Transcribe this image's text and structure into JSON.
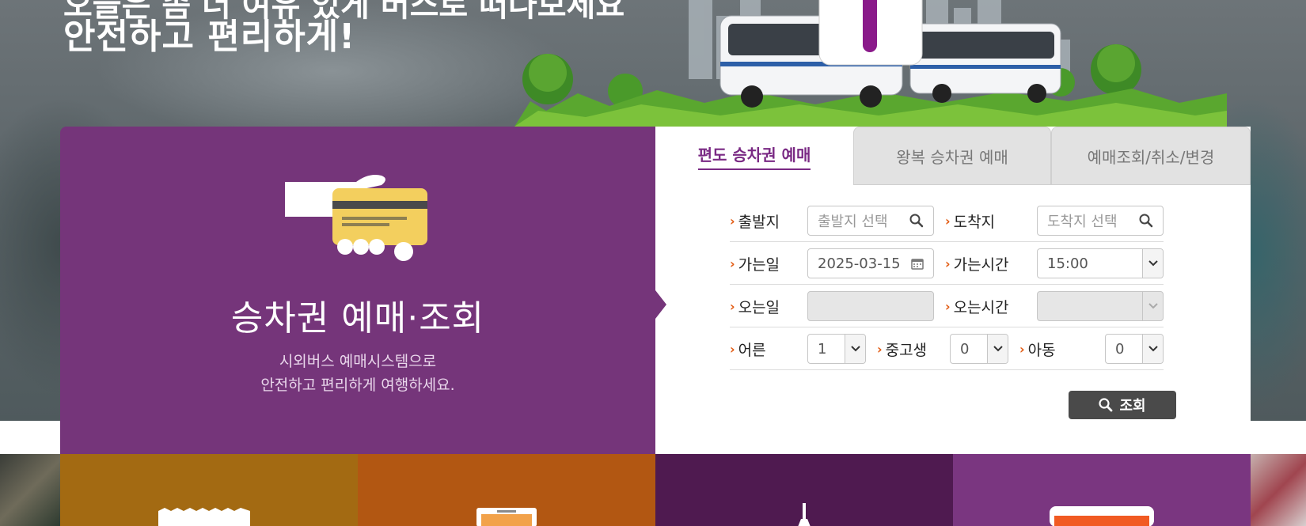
{
  "hero": {
    "title_top": "오늘은 좀 더 여유 있게 버스로 떠나보세요",
    "title": "안전하고 편리하게!"
  },
  "booking": {
    "panel_title": "승차권 예매·조회",
    "desc_line1": "시외버스 예매시스템으로",
    "desc_line2": "안전하고 편리하게 여행하세요."
  },
  "tabs": [
    {
      "label": "편도 승차권 예매",
      "active": true
    },
    {
      "label": "왕복 승차권 예매",
      "active": false
    },
    {
      "label": "예매조회/취소/변경",
      "active": false
    }
  ],
  "form": {
    "departure": {
      "label": "출발지",
      "placeholder": "출발지 선택"
    },
    "arrival": {
      "label": "도착지",
      "placeholder": "도착지 선택"
    },
    "go_date": {
      "label": "가는일",
      "value": "2025-03-15"
    },
    "go_time": {
      "label": "가는시간",
      "value": "15:00"
    },
    "return_date": {
      "label": "오는일",
      "value": ""
    },
    "return_time": {
      "label": "오는시간",
      "value": ""
    },
    "adult": {
      "label": "어른",
      "value": "1"
    },
    "youth": {
      "label": "중고생",
      "value": "0"
    },
    "child": {
      "label": "아동",
      "value": "0"
    },
    "search_label": "조회"
  },
  "colors": {
    "purple": "#75357a",
    "accent_text": "#7a2a84",
    "arrow": "#e25b12",
    "button": "#4a4a4a"
  },
  "icons": [
    "hand-card-icon",
    "search-icon",
    "calendar-icon",
    "chevron-down-icon"
  ]
}
